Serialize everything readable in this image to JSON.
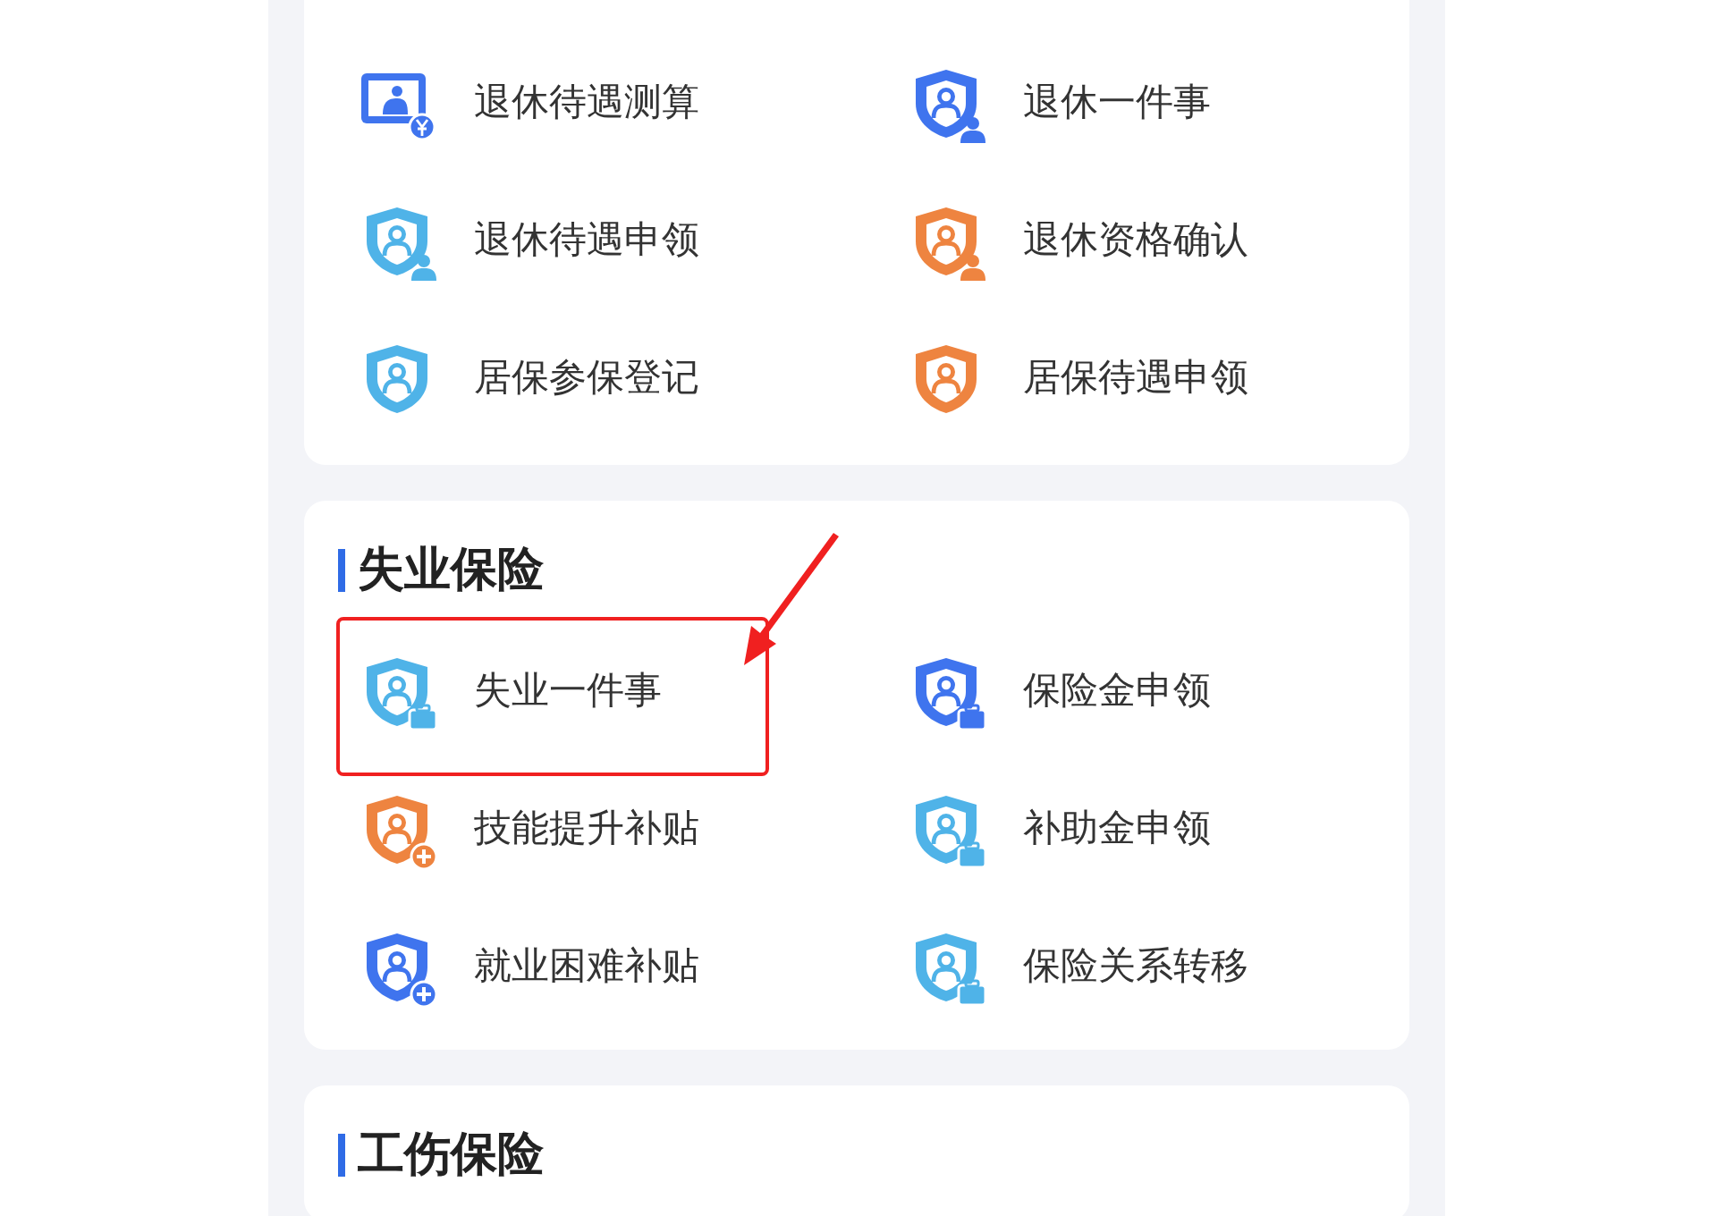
{
  "sections": [
    {
      "items": [
        {
          "label": "退休待遇测算",
          "kind": "screen-yen",
          "color": "#3f74ee"
        },
        {
          "label": "退休一件事",
          "kind": "shield-elder",
          "color": "#3f74ee"
        },
        {
          "label": "退休待遇申领",
          "kind": "shield-elder",
          "color": "#4fb3e8"
        },
        {
          "label": "退休资格确认",
          "kind": "shield-elder",
          "color": "#ee8440"
        },
        {
          "label": "居保参保登记",
          "kind": "shield",
          "color": "#4fb3e8"
        },
        {
          "label": "居保待遇申领",
          "kind": "shield",
          "color": "#ee8440"
        }
      ]
    },
    {
      "title": "失业保险",
      "items": [
        {
          "label": "失业一件事",
          "kind": "shield-briefcase",
          "color": "#4fb3e8"
        },
        {
          "label": "保险金申领",
          "kind": "shield-briefcase",
          "color": "#3f74ee"
        },
        {
          "label": "技能提升补贴",
          "kind": "shield-plus",
          "color": "#ee8440"
        },
        {
          "label": "补助金申领",
          "kind": "shield-briefcase",
          "color": "#4fb3e8"
        },
        {
          "label": "就业困难补贴",
          "kind": "shield-plus",
          "color": "#3f74ee"
        },
        {
          "label": "保险关系转移",
          "kind": "shield-briefcase",
          "color": "#4fb3e8"
        }
      ]
    },
    {
      "title": "工伤保险"
    }
  ]
}
